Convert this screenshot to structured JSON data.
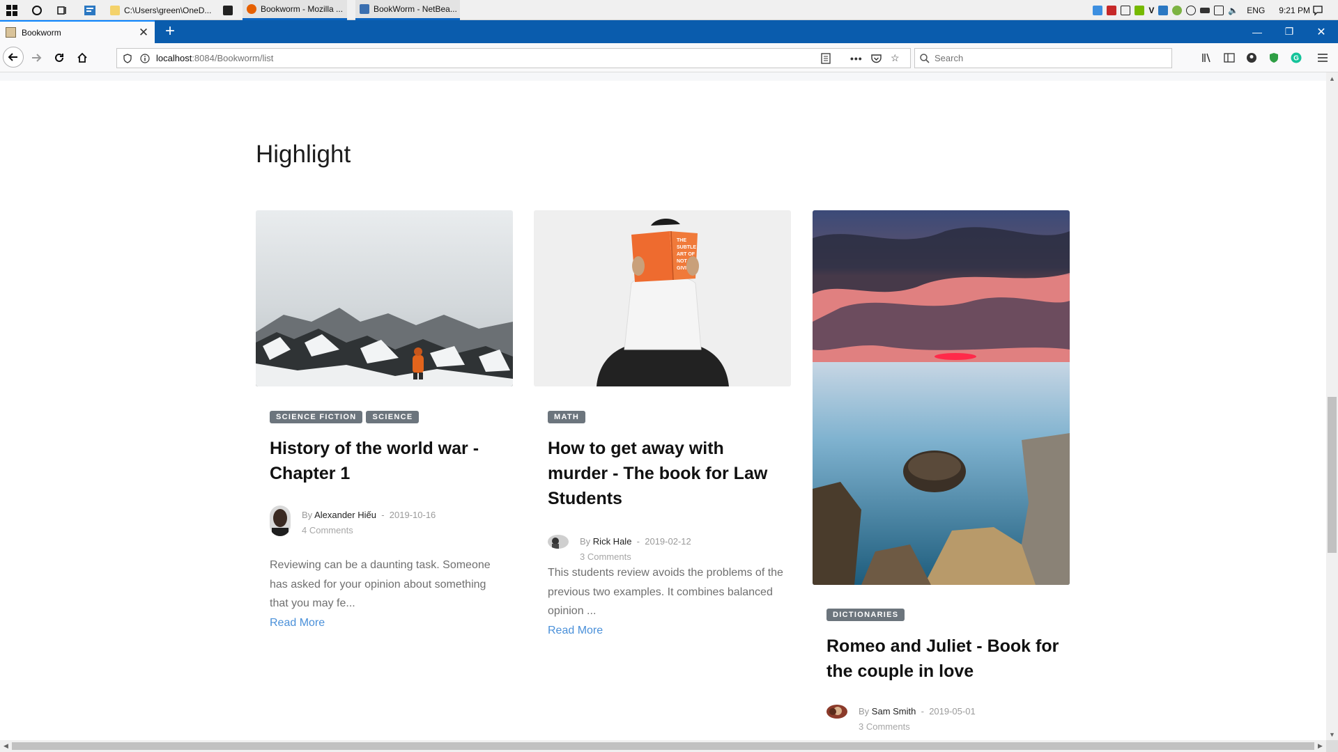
{
  "taskbar": {
    "items": [
      {
        "label": "C:\\Users\\green\\OneD...",
        "icon": "folder-icon"
      },
      {
        "label": "",
        "icon": "store-icon"
      },
      {
        "label": "Bookworm - Mozilla ...",
        "icon": "firefox-icon"
      },
      {
        "label": "BookWorm - NetBea...",
        "icon": "netbeans-icon"
      }
    ],
    "language": "ENG",
    "time": "9:21 PM"
  },
  "browser": {
    "tab_title": "Bookworm",
    "url_host": "localhost",
    "url_path": ":8084/Bookworm/list",
    "search_placeholder": "Search"
  },
  "page": {
    "section_title": "Highlight",
    "read_more_label": "Read More",
    "by_label": "By",
    "posts": [
      {
        "tags": [
          "SCIENCE FICTION",
          "SCIENCE"
        ],
        "title": "History of the world war - Chapter 1",
        "author": "Alexander Hiếu",
        "date": "2019-10-16",
        "comments": "4 Comments",
        "excerpt": "Reviewing can be a daunting task. Someone has asked for your opinion about something that you may fe...",
        "image": "mountain-hiker-image"
      },
      {
        "tags": [
          "MATH"
        ],
        "title": "How to get away with murder - The book for Law Students",
        "author": "Rick Hale",
        "date": "2019-02-12",
        "comments": "3 Comments",
        "excerpt": "This students review avoids the problems of the previous two examples. It combines balanced opinion ...",
        "image": "man-reading-book-image"
      },
      {
        "tags": [
          "DICTIONARIES"
        ],
        "title": "Romeo and Juliet - Book for the couple in love",
        "author": "Sam Smith",
        "date": "2019-05-01",
        "comments": "3 Comments",
        "excerpt": "",
        "image": "sunset-lake-image"
      }
    ]
  },
  "colors": {
    "tag_bg": "#6c757d",
    "link": "#4a90d9",
    "firefox_tabstrip": "#0a5cad"
  }
}
